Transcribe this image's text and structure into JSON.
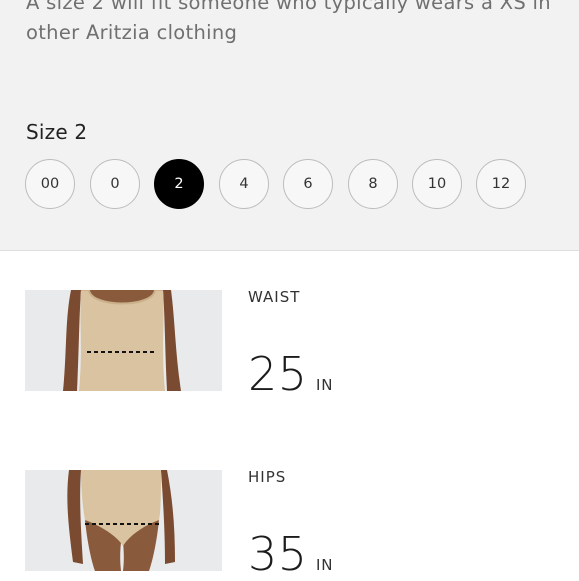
{
  "fit_description": "A size 2 will fit someone who typically wears a XS in other Aritzia clothing",
  "size_heading": "Size 2",
  "sizes": [
    {
      "label": "00",
      "selected": false
    },
    {
      "label": "0",
      "selected": false
    },
    {
      "label": "2",
      "selected": true
    },
    {
      "label": "4",
      "selected": false
    },
    {
      "label": "6",
      "selected": false
    },
    {
      "label": "8",
      "selected": false
    },
    {
      "label": "10",
      "selected": false
    },
    {
      "label": "12",
      "selected": false
    }
  ],
  "measurements": [
    {
      "label": "WAIST",
      "value": "25",
      "unit": "IN",
      "image_icon": "waist-measurement-image"
    },
    {
      "label": "HIPS",
      "value": "35",
      "unit": "IN",
      "image_icon": "hips-measurement-image"
    }
  ],
  "colors": {
    "panel_bg": "#f2f2f2",
    "selected_bg": "#000000",
    "skin": "#8a5a3c",
    "garment": "#d9c3a0"
  }
}
